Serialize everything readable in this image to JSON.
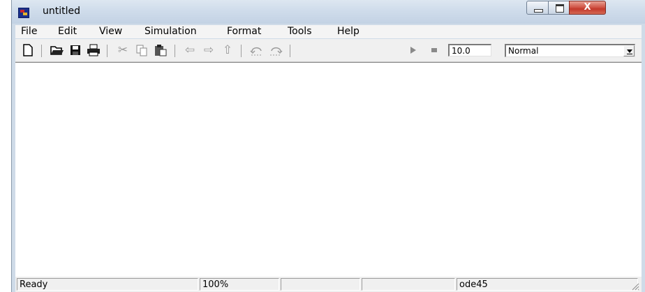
{
  "window": {
    "title": "untitled",
    "app_icon": "simulink-model-icon"
  },
  "title_buttons": {
    "minimize_icon": "minimize-icon",
    "maximize_icon": "maximize-icon",
    "close_glyph": "X"
  },
  "menu": [
    {
      "label": "File"
    },
    {
      "label": "Edit"
    },
    {
      "label": "View"
    },
    {
      "label": "Simulation"
    },
    {
      "label": "Format"
    },
    {
      "label": "Tools"
    },
    {
      "label": "Help"
    }
  ],
  "toolbar": {
    "icons": {
      "new": "new-file-icon",
      "open": "open-folder-icon",
      "save": "save-icon",
      "print": "print-icon",
      "cut": "cut-icon",
      "copy": "copy-icon",
      "paste": "paste-icon",
      "back": "back-arrow-icon",
      "forward": "forward-arrow-icon",
      "up": "up-arrow-icon",
      "undo": "undo-icon",
      "redo": "redo-icon",
      "start": "start-simulation-icon",
      "stop": "stop-simulation-icon"
    },
    "stop_time": "10.0",
    "sim_mode": "Normal"
  },
  "status": {
    "state": "Ready",
    "zoom": "100%",
    "solver": "ode45"
  }
}
